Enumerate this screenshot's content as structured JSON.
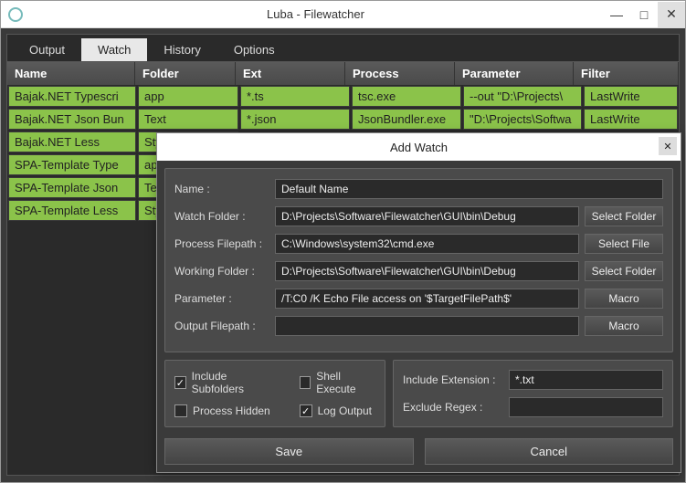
{
  "window": {
    "title": "Luba - Filewatcher"
  },
  "tabs": {
    "output": "Output",
    "watch": "Watch",
    "history": "History",
    "options": "Options"
  },
  "grid": {
    "headers": {
      "name": "Name",
      "folder": "Folder",
      "ext": "Ext",
      "process": "Process",
      "parameter": "Parameter",
      "filter": "Filter"
    },
    "rows": [
      {
        "name": "Bajak.NET Typescri",
        "folder": "app",
        "ext": "*.ts",
        "process": "tsc.exe",
        "parameter": "--out \"D:\\Projects\\",
        "filter": "LastWrite"
      },
      {
        "name": "Bajak.NET Json Bun",
        "folder": "Text",
        "ext": "*.json",
        "process": "JsonBundler.exe",
        "parameter": "\"D:\\Projects\\Softwa",
        "filter": "LastWrite"
      },
      {
        "name": "Bajak.NET Less",
        "folder": "Styl",
        "ext": "",
        "process": "",
        "parameter": "",
        "filter": ""
      },
      {
        "name": "SPA-Template Type",
        "folder": "app",
        "ext": "",
        "process": "",
        "parameter": "",
        "filter": ""
      },
      {
        "name": "SPA-Template Json",
        "folder": "Text",
        "ext": "",
        "process": "",
        "parameter": "",
        "filter": ""
      },
      {
        "name": "SPA-Template Less",
        "folder": "Styl",
        "ext": "",
        "process": "",
        "parameter": "",
        "filter": ""
      }
    ]
  },
  "dialog": {
    "title": "Add Watch",
    "labels": {
      "name": "Name :",
      "watchFolder": "Watch Folder :",
      "processFilepath": "Process Filepath :",
      "workingFolder": "Working Folder :",
      "parameter": "Parameter :",
      "outputFilepath": "Output Filepath :"
    },
    "values": {
      "name": "Default Name",
      "watchFolder": "D:\\Projects\\Software\\Filewatcher\\GUI\\bin\\Debug",
      "processFilepath": "C:\\Windows\\system32\\cmd.exe",
      "workingFolder": "D:\\Projects\\Software\\Filewatcher\\GUI\\bin\\Debug",
      "parameter": "/T:C0 /K Echo File access on '$TargetFilePath$'",
      "outputFilepath": ""
    },
    "buttons": {
      "selectFolder": "Select Folder",
      "selectFile": "Select File",
      "macro": "Macro",
      "save": "Save",
      "cancel": "Cancel"
    },
    "checks": {
      "includeSubfolders": "Include Subfolders",
      "shellExecute": "Shell Execute",
      "processHidden": "Process Hidden",
      "logOutput": "Log Output"
    },
    "filter": {
      "includeExtLabel": "Include Extension :",
      "includeExtValue": "*.txt",
      "excludeRegexLabel": "Exclude Regex :",
      "excludeRegexValue": ""
    }
  }
}
